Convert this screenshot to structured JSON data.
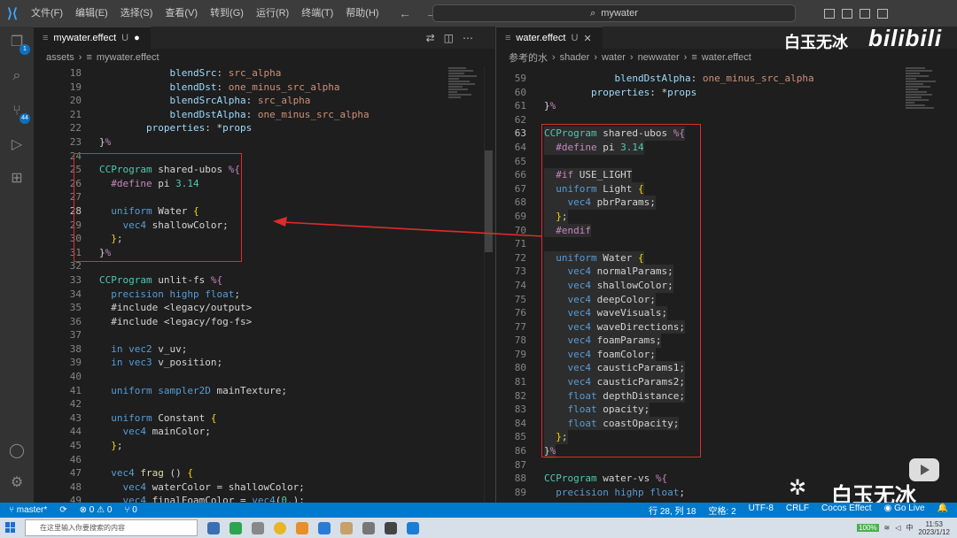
{
  "titlebar": {
    "menu": [
      "文件(F)",
      "编辑(E)",
      "选择(S)",
      "查看(V)",
      "转到(G)",
      "运行(R)",
      "终端(T)",
      "帮助(H)"
    ],
    "search_text": "mywater"
  },
  "activity": {
    "explorer_badge": "1",
    "scm_badge": "44"
  },
  "left_editor": {
    "tab": {
      "name": "mywater.effect",
      "status": "U"
    },
    "breadcrumb": [
      "assets",
      "mywater.effect"
    ],
    "lines": [
      {
        "n": "18",
        "html": "            <span class='v'>blendSrc</span>: <span class='s'>src_alpha</span>"
      },
      {
        "n": "19",
        "html": "            <span class='v'>blendDst</span>: <span class='s'>one_minus_src_alpha</span>"
      },
      {
        "n": "20",
        "html": "            <span class='v'>blendSrcAlpha</span>: <span class='s'>src_alpha</span>"
      },
      {
        "n": "21",
        "html": "            <span class='v'>blendDstAlpha</span>: <span class='s'>one_minus_src_alpha</span>"
      },
      {
        "n": "22",
        "html": "        <span class='v'>properties</span>: *<span class='v'>props</span>"
      },
      {
        "n": "23",
        "html": "}<span class='p'>%</span>"
      },
      {
        "n": "24",
        "html": ""
      },
      {
        "n": "25",
        "html": "<span class='t'>CCProgram</span> shared-ubos <span class='p'>%{</span>"
      },
      {
        "n": "26",
        "html": "  <span class='p'>#define</span> pi <span class='t'>3.14</span>"
      },
      {
        "n": "27",
        "html": ""
      },
      {
        "n": "28",
        "html": "  <span class='k'>uniform</span> Water <span class='y'>{</span>"
      },
      {
        "n": "29",
        "html": "    <span class='k'>vec4</span> shallowColor;"
      },
      {
        "n": "30",
        "html": "  <span class='y'>}</span>;"
      },
      {
        "n": "31",
        "html": "}<span class='p'>%</span>"
      },
      {
        "n": "32",
        "html": ""
      },
      {
        "n": "33",
        "html": "<span class='t'>CCProgram</span> unlit-fs <span class='p'>%{</span>"
      },
      {
        "n": "34",
        "html": "  <span class='k'>precision</span> <span class='k'>highp</span> <span class='k'>float</span>;"
      },
      {
        "n": "35",
        "html": "  #include &lt;legacy/output&gt;"
      },
      {
        "n": "36",
        "html": "  #include &lt;legacy/fog-fs&gt;"
      },
      {
        "n": "37",
        "html": ""
      },
      {
        "n": "38",
        "html": "  <span class='k'>in</span> <span class='k'>vec2</span> v_uv;"
      },
      {
        "n": "39",
        "html": "  <span class='k'>in</span> <span class='k'>vec3</span> v_position;"
      },
      {
        "n": "40",
        "html": ""
      },
      {
        "n": "41",
        "html": "  <span class='k'>uniform</span> <span class='k'>sampler2D</span> mainTexture;"
      },
      {
        "n": "42",
        "html": ""
      },
      {
        "n": "43",
        "html": "  <span class='k'>uniform</span> Constant <span class='y'>{</span>"
      },
      {
        "n": "44",
        "html": "    <span class='k'>vec4</span> mainColor;"
      },
      {
        "n": "45",
        "html": "  <span class='y'>}</span>;"
      },
      {
        "n": "46",
        "html": ""
      },
      {
        "n": "47",
        "html": "  <span class='k'>vec4</span> <span class='f'>frag</span> () <span class='y'>{</span>"
      },
      {
        "n": "48",
        "html": "    <span class='k'>vec4</span> waterColor = shallowColor;"
      },
      {
        "n": "49",
        "html": "    <span class='k'>vec4</span> finalFoamColor = <span class='k'>vec4</span>(<span class='t'>0.</span>);"
      }
    ]
  },
  "right_editor": {
    "tab": {
      "name": "water.effect",
      "status": "U"
    },
    "breadcrumb": [
      "参考的水",
      "shader",
      "water",
      "newwater",
      "water.effect"
    ],
    "lines": [
      {
        "n": "59",
        "html": "            <span class='v'>blendDstAlpha</span>: <span class='s'>one_minus_src_alpha</span>"
      },
      {
        "n": "60",
        "html": "        <span class='v'>properties</span>: *<span class='v'>props</span>"
      },
      {
        "n": "61",
        "html": "}<span class='p'>%</span>"
      },
      {
        "n": "62",
        "html": ""
      },
      {
        "n": "63",
        "html": "<span class='t'>CCProgram</span> shared-ubos <span class='p'>%{</span>"
      },
      {
        "n": "64",
        "html": "  <span class='p'>#define</span> pi <span class='t'>3.14</span>"
      },
      {
        "n": "65",
        "html": ""
      },
      {
        "n": "66",
        "html": "  <span class='p'>#if</span> USE_LIGHT"
      },
      {
        "n": "67",
        "html": "  <span class='k'>uniform</span> Light <span class='y'>{</span>"
      },
      {
        "n": "68",
        "html": "    <span class='k'>vec4</span> pbrParams;"
      },
      {
        "n": "69",
        "html": "  <span class='y'>}</span>;"
      },
      {
        "n": "70",
        "html": "  <span class='p'>#endif</span>"
      },
      {
        "n": "71",
        "html": ""
      },
      {
        "n": "72",
        "html": "  <span class='k'>uniform</span> Water <span class='y'>{</span>"
      },
      {
        "n": "73",
        "html": "    <span class='k'>vec4</span> normalParams;"
      },
      {
        "n": "74",
        "html": "    <span class='k'>vec4</span> shallowColor;"
      },
      {
        "n": "75",
        "html": "    <span class='k'>vec4</span> deepColor;"
      },
      {
        "n": "76",
        "html": "    <span class='k'>vec4</span> waveVisuals;"
      },
      {
        "n": "77",
        "html": "    <span class='k'>vec4</span> waveDirections;"
      },
      {
        "n": "78",
        "html": "    <span class='k'>vec4</span> foamParams;"
      },
      {
        "n": "79",
        "html": "    <span class='k'>vec4</span> foamColor;"
      },
      {
        "n": "80",
        "html": "    <span class='k'>vec4</span> causticParams1;"
      },
      {
        "n": "81",
        "html": "    <span class='k'>vec4</span> causticParams2;"
      },
      {
        "n": "82",
        "html": "    <span class='k'>float</span> depthDistance;"
      },
      {
        "n": "83",
        "html": "    <span class='k'>float</span> opacity;"
      },
      {
        "n": "84",
        "html": "    <span class='k'>float</span> coastOpacity;"
      },
      {
        "n": "85",
        "html": "  <span class='y'>}</span>;"
      },
      {
        "n": "86",
        "html": "}<span class='p'>%</span>"
      },
      {
        "n": "87",
        "html": ""
      },
      {
        "n": "88",
        "html": "<span class='t'>CCProgram</span> water-vs <span class='p'>%{</span>"
      },
      {
        "n": "89",
        "html": "  <span class='k'>precision</span> <span class='k'>highp</span> <span class='k'>float</span>;"
      }
    ]
  },
  "statusbar": {
    "branch": "master*",
    "problems": "⊗ 0 ⚠ 0",
    "ports": "⑂ 0",
    "position": "行 28, 列 18",
    "spaces": "空格: 2",
    "encoding": "UTF-8",
    "eol": "CRLF",
    "language": "Cocos Effect",
    "golive": "Go Live"
  },
  "taskbar": {
    "search_placeholder": "在这里输入你要搜索的内容",
    "battery": "100%",
    "ime": "中",
    "time": "11:53",
    "date": "2023/1/12"
  },
  "watermark": {
    "channel": "白玉无冰",
    "site": "bilibili",
    "wechat": "白玉无冰"
  },
  "colors": {
    "accent": "#007acc",
    "annotation": "#e02b2b"
  }
}
